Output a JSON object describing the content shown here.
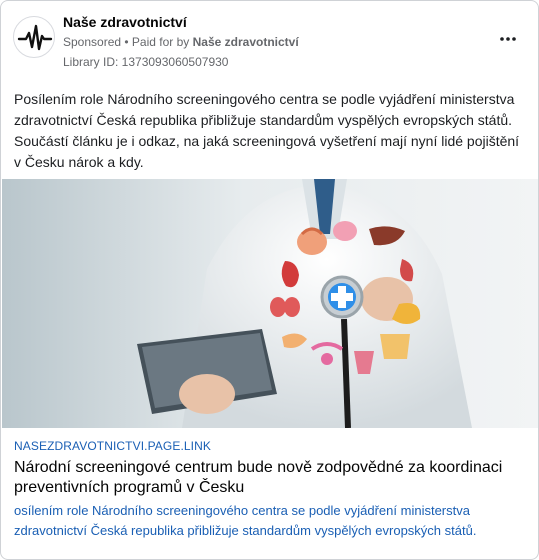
{
  "ad": {
    "page_name": "Naše zdravotnictví",
    "sponsored": "Sponsored",
    "paid_for_prefix": " • Paid for by ",
    "paid_for_by": "Naše zdravotnictví",
    "library_id": "Library ID: 1373093060507930",
    "more_icon": "more-horizontal-icon",
    "body_text": "Posílením role Národního screeningového centra se podle vyjádření ministerstva zdravotnictví Česká republika přibližuje standardům vyspělých evropských států. Součástí článku je i odkaz, na jaká screeningová vyšetření mají nyní lidé pojištění v Česku nárok a kdy.",
    "link": {
      "domain": "NASEZDRAVOTNICTVI.PAGE.LINK",
      "title": "Národní screeningové centrum bude nově zodpovědné za koordinaci preventivních programů v Česku",
      "description": "osílením role Národního screeningového centra se podle vyjádření ministerstva zdravotnictví Česká republika přibližuje standardům vyspělých evropských států."
    }
  },
  "colors": {
    "link_blue": "#1a5fb4",
    "muted": "#65676b",
    "medical_cross": "#2f8fe8"
  }
}
